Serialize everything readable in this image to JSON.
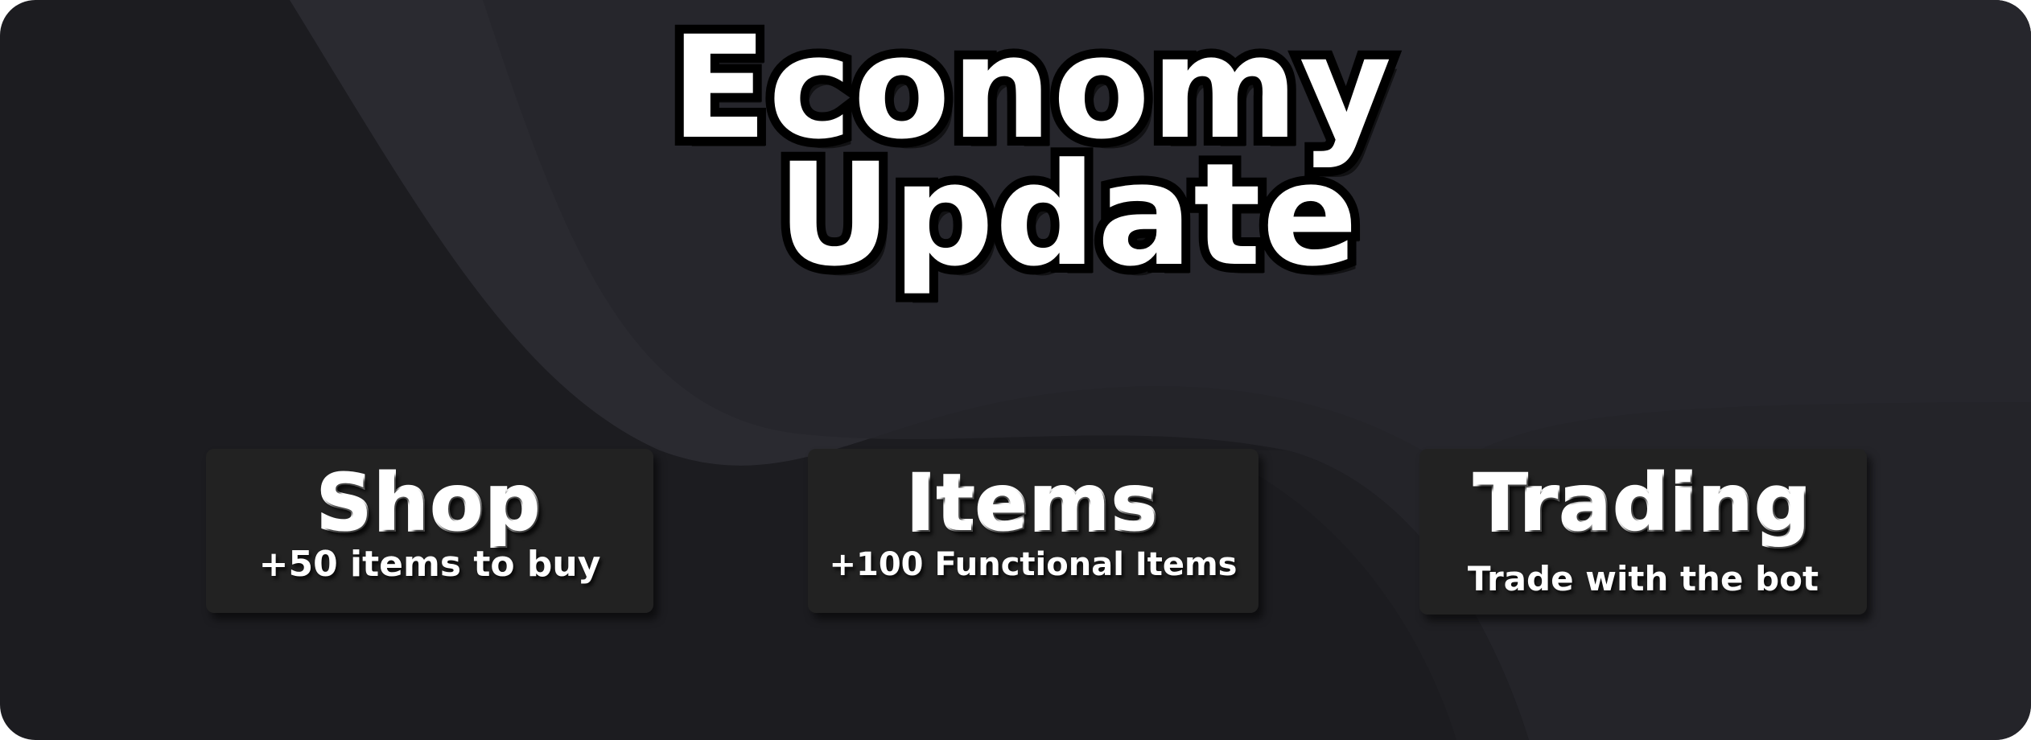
{
  "colors": {
    "background": "#1c1c20",
    "wave_light": "#2a2a30",
    "card": "#222222",
    "text": "#ffffff",
    "outline": "#000000"
  },
  "title": {
    "line1": "Economy",
    "line2": "Update"
  },
  "features": [
    {
      "heading": "Shop",
      "subtitle": "+50 items to buy"
    },
    {
      "heading": "Items",
      "subtitle": "+100 Functional Items"
    },
    {
      "heading": "Trading",
      "subtitle": "Trade with the bot"
    }
  ]
}
